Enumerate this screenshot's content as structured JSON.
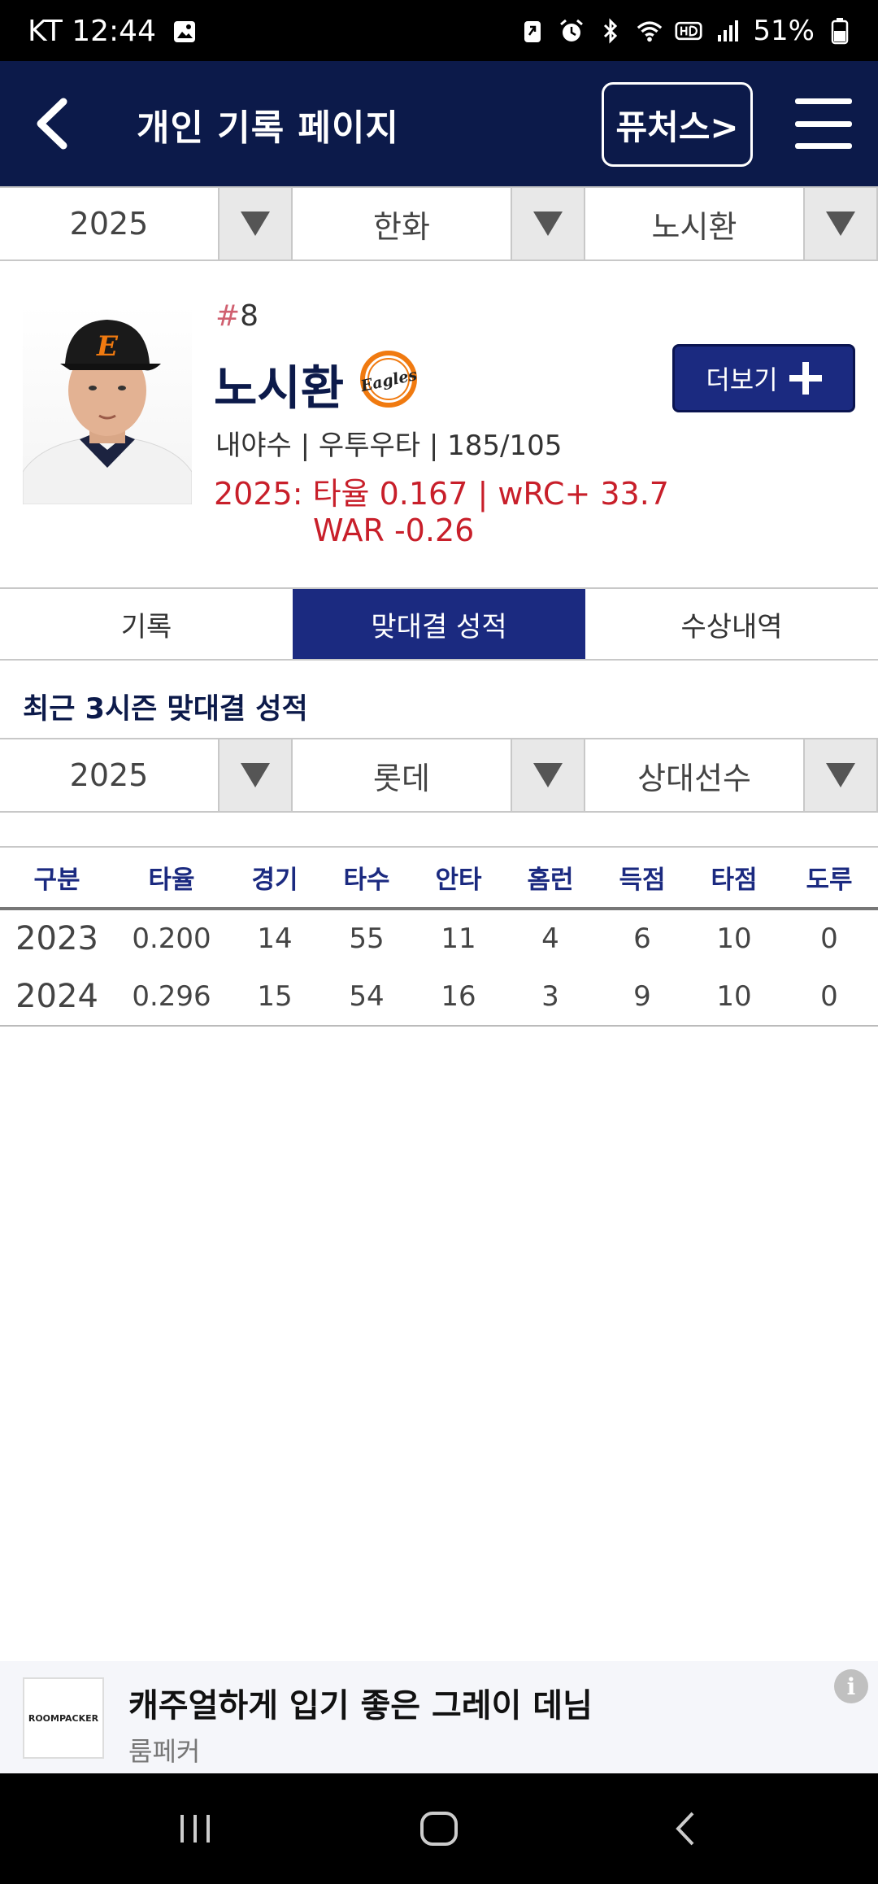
{
  "status_bar": {
    "carrier_time": "KT 12:44",
    "battery": "51%"
  },
  "header": {
    "title": "개인 기록 페이지",
    "futures_label": "퓨처스>"
  },
  "filters": {
    "year": "2025",
    "team": "한화",
    "player": "노시환"
  },
  "player": {
    "number_hash": "#",
    "number": "8",
    "name": "노시환",
    "team_logo_text": "Eagles",
    "more_label": "더보기",
    "info": "내야수 | 우투우타 | 185/105",
    "season_stats": "2025: 타율 0.167 | wRC+ 33.7",
    "war": "WAR -0.26"
  },
  "tabs": [
    {
      "label": "기록",
      "active": false
    },
    {
      "label": "맞대결 성적",
      "active": true
    },
    {
      "label": "수상내역",
      "active": false
    }
  ],
  "matchup": {
    "section_title": "최근 3시즌 맞대결 성적",
    "filters": {
      "year": "2025",
      "opponent": "롯데",
      "opponent_player": "상대선수"
    },
    "columns": [
      "구분",
      "타율",
      "경기",
      "타수",
      "안타",
      "홈런",
      "득점",
      "타점",
      "도루"
    ],
    "rows": [
      [
        "2023",
        "0.200",
        "14",
        "55",
        "11",
        "4",
        "6",
        "10",
        "0"
      ],
      [
        "2024",
        "0.296",
        "15",
        "54",
        "16",
        "3",
        "9",
        "10",
        "0"
      ]
    ]
  },
  "ad": {
    "logo_text": "ROOMPACKER",
    "title": "캐주얼하게 입기 좋은 그레이 데님",
    "advertiser": "룸페커",
    "info_glyph": "i"
  },
  "colors": {
    "header_bg": "#0c1a4a",
    "accent": "#1b2a80",
    "stat_red": "#c81f2a"
  }
}
